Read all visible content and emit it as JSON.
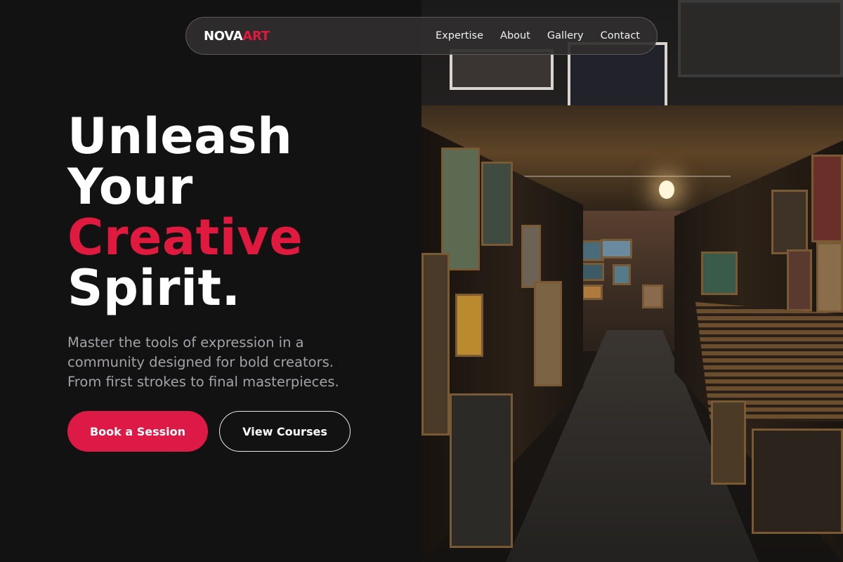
{
  "brand": {
    "logo_part1": "NOVA",
    "logo_part2": "ART",
    "accent_color": "#e0193f"
  },
  "nav": {
    "links": [
      {
        "label": "Expertise"
      },
      {
        "label": "About"
      },
      {
        "label": "Gallery"
      },
      {
        "label": "Contact"
      }
    ]
  },
  "hero": {
    "headline_line1": "Unleash",
    "headline_line2": "Your",
    "headline_line3": "Creative",
    "headline_line4": "Spirit.",
    "subtitle": "Master the tools of expression in a community designed for bold creators. From first strokes to final masterpieces.",
    "primary_cta": "Book a Session",
    "secondary_cta": "View Courses"
  },
  "colors": {
    "background": "#131213",
    "button_primary": "#dc1a45",
    "text_muted": "#a4a2a6"
  }
}
